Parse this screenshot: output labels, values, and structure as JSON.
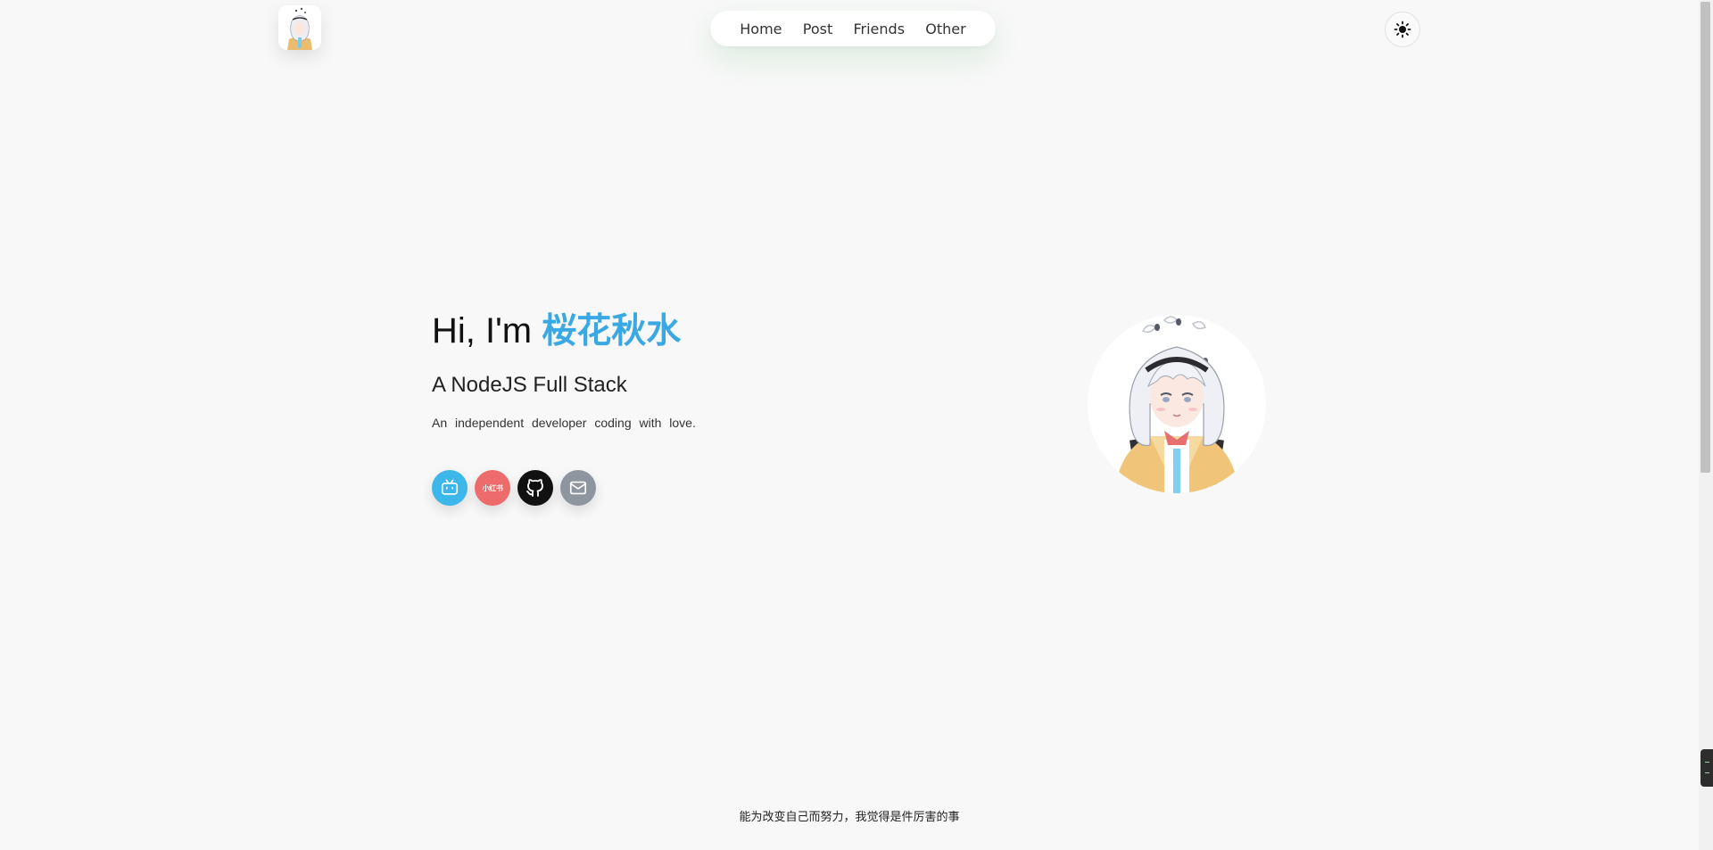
{
  "header": {
    "logo_alt": "avatar logo",
    "nav": [
      {
        "label": "Home"
      },
      {
        "label": "Post"
      },
      {
        "label": "Friends"
      },
      {
        "label": "Other"
      }
    ],
    "theme_icon": "sun-icon"
  },
  "hero": {
    "greeting": "Hi, I'm ",
    "name": "桜花秋水",
    "subtitle": "A NodeJS Full Stack",
    "tagline": "An independent developer coding with love."
  },
  "socials": [
    {
      "name": "bilibili",
      "icon": "bilibili-icon",
      "color": "#3db7ea"
    },
    {
      "name": "xiaohongshu",
      "icon": "xiaohongshu-icon",
      "label": "小红书",
      "color": "#ee6b6b"
    },
    {
      "name": "github",
      "icon": "github-icon",
      "color": "#111111"
    },
    {
      "name": "email",
      "icon": "mail-icon",
      "color": "#8e959f"
    }
  ],
  "footer": {
    "quote": "能为改变自己而努力，我觉得是件厉害的事"
  },
  "colors": {
    "accent": "#3aa9e3",
    "background": "#f8f8f8"
  }
}
